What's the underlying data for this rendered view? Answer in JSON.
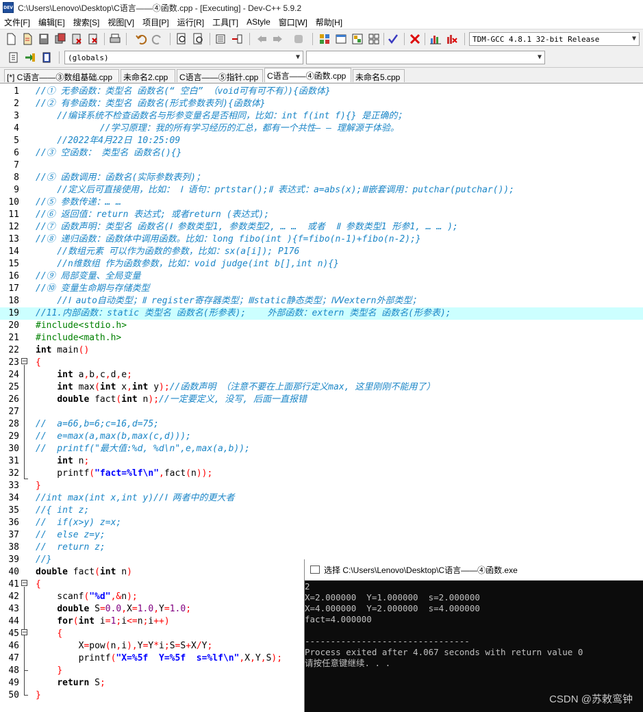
{
  "window": {
    "title": "C:\\Users\\Lenovo\\Desktop\\C语言——④函数.cpp - [Executing] - Dev-C++ 5.9.2",
    "app_icon_label": "DEV"
  },
  "menu": [
    "文件[F]",
    "编辑[E]",
    "搜索[S]",
    "视图[V]",
    "项目[P]",
    "运行[R]",
    "工具[T]",
    "AStyle",
    "窗口[W]",
    "帮助[H]"
  ],
  "toolbar": {
    "compiler_select": "TDM-GCC 4.8.1 32-bit Release",
    "scope_select": "(globals)",
    "member_select": ""
  },
  "tabs": [
    {
      "label": "[*] C语言——③数组基础.cpp",
      "active": false
    },
    {
      "label": "未命名2.cpp",
      "active": false
    },
    {
      "label": "C语言——⑤指针.cpp",
      "active": false
    },
    {
      "label": "C语言——④函数.cpp",
      "active": true
    },
    {
      "label": "未命名5.cpp",
      "active": false
    }
  ],
  "highlighted_line": 19,
  "code_lines": [
    [
      [
        "cm",
        "//① 无参函数：类型名 函数名(“ 空白” （void可有可不有）){函数体}"
      ]
    ],
    [
      [
        "cm",
        "//② 有参函数：类型名 函数名(形式参数表列){函数体}"
      ]
    ],
    [
      [
        "cm",
        "    //编译系统不检查函数名与形参变量名是否相同，比如：int f(int f){} 是正确的；"
      ]
    ],
    [
      [
        "cm",
        "            //学习原理：我的所有学习经历的汇总，都有一个共性— — 理解源于体验。"
      ]
    ],
    [
      [
        "cm",
        "    //2022年4月22日 10:25:09"
      ]
    ],
    [
      [
        "cm",
        "//③ 空函数： 类型名 函数名(){}"
      ]
    ],
    [],
    [
      [
        "cm",
        "//⑤ 函数调用：函数名(实际参数表列)；"
      ]
    ],
    [
      [
        "cm",
        "    //定义后可直接使用，比如： Ⅰ 语句：prtstar();Ⅱ 表达式：a=abs(x);Ⅲ嵌套调用：putchar(putchar());"
      ]
    ],
    [
      [
        "cm",
        "//⑤ 参数传递：… …"
      ]
    ],
    [
      [
        "cm",
        "//⑥ 返回值：return 表达式; 或者return (表达式);"
      ]
    ],
    [
      [
        "cm",
        "//⑦ 函数声明：类型名 函数名(Ⅰ 参数类型1, 参数类型2, … …  或者  Ⅱ 参数类型1 形参1, … … );"
      ]
    ],
    [
      [
        "cm",
        "//⑧ 递归函数：函数体中调用函数。比如：long fibo(int ){f=fibo(n-1)+fibo(n-2);}"
      ]
    ],
    [
      [
        "cm",
        "    //数组元素 可以作为函数的参数，比如：sx(a[i]); P176"
      ]
    ],
    [
      [
        "cm",
        "    //n维数组 作为函数参数，比如：void judge(int b[],int n){}"
      ]
    ],
    [
      [
        "cm",
        "//⑨ 局部变量、全局变量"
      ]
    ],
    [
      [
        "cm",
        "//⑩ 变量生命期与存储类型"
      ]
    ],
    [
      [
        "cm",
        "    //Ⅰ auto自动类型；Ⅱ register寄存器类型；Ⅲstatic静态类型；ⅣVextern外部类型；"
      ]
    ],
    [
      [
        "cm",
        "//11.内部函数：static 类型名 函数名(形参表);    外部函数：extern 类型名 函数名(形参表);"
      ]
    ],
    [
      [
        "pp",
        "#include<stdio.h>"
      ]
    ],
    [
      [
        "pp",
        "#include<math.h>"
      ]
    ],
    [
      [
        "kw",
        "int"
      ],
      [
        "tx",
        " main"
      ],
      [
        "sy",
        "()"
      ]
    ],
    [
      [
        "sy",
        "{"
      ]
    ],
    [
      [
        "tx",
        "    "
      ],
      [
        "kw",
        "int"
      ],
      [
        "tx",
        " a"
      ],
      [
        "sy",
        ","
      ],
      [
        "tx",
        "b"
      ],
      [
        "sy",
        ","
      ],
      [
        "tx",
        "c"
      ],
      [
        "sy",
        ","
      ],
      [
        "tx",
        "d"
      ],
      [
        "sy",
        ","
      ],
      [
        "tx",
        "e"
      ],
      [
        "sy",
        ";"
      ]
    ],
    [
      [
        "tx",
        "    "
      ],
      [
        "kw",
        "int"
      ],
      [
        "tx",
        " max"
      ],
      [
        "sy",
        "("
      ],
      [
        "kw",
        "int"
      ],
      [
        "tx",
        " x"
      ],
      [
        "sy",
        ","
      ],
      [
        "kw",
        "int"
      ],
      [
        "tx",
        " y"
      ],
      [
        "sy",
        ");"
      ],
      [
        "cm",
        "//函数声明 （注意不要在上面那行定义max, 这里刚刚不能用了）"
      ]
    ],
    [
      [
        "tx",
        "    "
      ],
      [
        "kw",
        "double"
      ],
      [
        "tx",
        " fact"
      ],
      [
        "sy",
        "("
      ],
      [
        "kw",
        "int"
      ],
      [
        "tx",
        " n"
      ],
      [
        "sy",
        ");"
      ],
      [
        "cm",
        "//一定要定义, 没写, 后面一直报错"
      ]
    ],
    [],
    [
      [
        "cm",
        "//  a=66,b=6;c=16,d=75;"
      ]
    ],
    [
      [
        "cm",
        "//  e=max(a,max(b,max(c,d)));"
      ]
    ],
    [
      [
        "cm",
        "//  printf(\"最大值:%d, %d\\n\",e,max(a,b));"
      ]
    ],
    [
      [
        "tx",
        "    "
      ],
      [
        "kw",
        "int"
      ],
      [
        "tx",
        " n"
      ],
      [
        "sy",
        ";"
      ]
    ],
    [
      [
        "tx",
        "    printf"
      ],
      [
        "sy",
        "("
      ],
      [
        "st",
        "\"fact=%lf\\n\""
      ],
      [
        "sy",
        ","
      ],
      [
        "tx",
        "fact"
      ],
      [
        "sy",
        "("
      ],
      [
        "tx",
        "n"
      ],
      [
        "sy",
        "));"
      ]
    ],
    [
      [
        "sy",
        "}"
      ]
    ],
    [
      [
        "cm",
        "//int max(int x,int y)//Ⅰ 两者中的更大者"
      ]
    ],
    [
      [
        "cm",
        "//{ int z;"
      ]
    ],
    [
      [
        "cm",
        "//  if(x>y) z=x;"
      ]
    ],
    [
      [
        "cm",
        "//  else z=y;"
      ]
    ],
    [
      [
        "cm",
        "//  return z;"
      ]
    ],
    [
      [
        "cm",
        "//}"
      ]
    ],
    [
      [
        "kw",
        "double"
      ],
      [
        "tx",
        " fact"
      ],
      [
        "sy",
        "("
      ],
      [
        "kw",
        "int"
      ],
      [
        "tx",
        " n"
      ],
      [
        "sy",
        ")"
      ]
    ],
    [
      [
        "sy",
        "{"
      ]
    ],
    [
      [
        "tx",
        "    scanf"
      ],
      [
        "sy",
        "("
      ],
      [
        "st",
        "\"%d\""
      ],
      [
        "sy",
        ",&"
      ],
      [
        "tx",
        "n"
      ],
      [
        "sy",
        ");"
      ]
    ],
    [
      [
        "tx",
        "    "
      ],
      [
        "kw",
        "double"
      ],
      [
        "tx",
        " S"
      ],
      [
        "sy",
        "="
      ],
      [
        "nu",
        "0.0"
      ],
      [
        "sy",
        ","
      ],
      [
        "tx",
        "X"
      ],
      [
        "sy",
        "="
      ],
      [
        "nu",
        "1.0"
      ],
      [
        "sy",
        ","
      ],
      [
        "tx",
        "Y"
      ],
      [
        "sy",
        "="
      ],
      [
        "nu",
        "1.0"
      ],
      [
        "sy",
        ";"
      ]
    ],
    [
      [
        "tx",
        "    "
      ],
      [
        "kw",
        "for"
      ],
      [
        "sy",
        "("
      ],
      [
        "kw",
        "int"
      ],
      [
        "tx",
        " i"
      ],
      [
        "sy",
        "="
      ],
      [
        "nu",
        "1"
      ],
      [
        "sy",
        ";"
      ],
      [
        "tx",
        "i"
      ],
      [
        "sy",
        "<="
      ],
      [
        "tx",
        "n"
      ],
      [
        "sy",
        ";"
      ],
      [
        "tx",
        "i"
      ],
      [
        "sy",
        "++)"
      ]
    ],
    [
      [
        "tx",
        "    "
      ],
      [
        "sy",
        "{"
      ]
    ],
    [
      [
        "tx",
        "        X"
      ],
      [
        "sy",
        "="
      ],
      [
        "tx",
        "pow"
      ],
      [
        "sy",
        "("
      ],
      [
        "tx",
        "n"
      ],
      [
        "sy",
        ","
      ],
      [
        "tx",
        "i"
      ],
      [
        "sy",
        "),"
      ],
      [
        "tx",
        "Y"
      ],
      [
        "sy",
        "="
      ],
      [
        "tx",
        "Y"
      ],
      [
        "sy",
        "*"
      ],
      [
        "tx",
        "i"
      ],
      [
        "sy",
        ";"
      ],
      [
        "tx",
        "S"
      ],
      [
        "sy",
        "="
      ],
      [
        "tx",
        "S"
      ],
      [
        "sy",
        "+"
      ],
      [
        "tx",
        "X"
      ],
      [
        "sy",
        "/"
      ],
      [
        "tx",
        "Y"
      ],
      [
        "sy",
        ";"
      ]
    ],
    [
      [
        "tx",
        "        printf"
      ],
      [
        "sy",
        "("
      ],
      [
        "st",
        "\"X=%5f  Y=%5f  s=%lf\\n\""
      ],
      [
        "sy",
        ","
      ],
      [
        "tx",
        "X"
      ],
      [
        "sy",
        ","
      ],
      [
        "tx",
        "Y"
      ],
      [
        "sy",
        ","
      ],
      [
        "tx",
        "S"
      ],
      [
        "sy",
        ");"
      ]
    ],
    [
      [
        "tx",
        "    "
      ],
      [
        "sy",
        "}"
      ]
    ],
    [
      [
        "tx",
        "    "
      ],
      [
        "kw",
        "return"
      ],
      [
        "tx",
        " S"
      ],
      [
        "sy",
        ";"
      ]
    ],
    [
      [
        "sy",
        "}"
      ]
    ]
  ],
  "console": {
    "title": "选择 C:\\Users\\Lenovo\\Desktop\\C语言——④函数.exe",
    "lines": [
      "2",
      "X=2.000000  Y=1.000000  s=2.000000",
      "X=4.000000  Y=2.000000  s=4.000000",
      "fact=4.000000",
      "",
      "--------------------------------",
      "Process exited after 4.067 seconds with return value 0",
      "请按任意键继续. . ."
    ]
  },
  "watermark": "CSDN @苏敕鸾钟"
}
